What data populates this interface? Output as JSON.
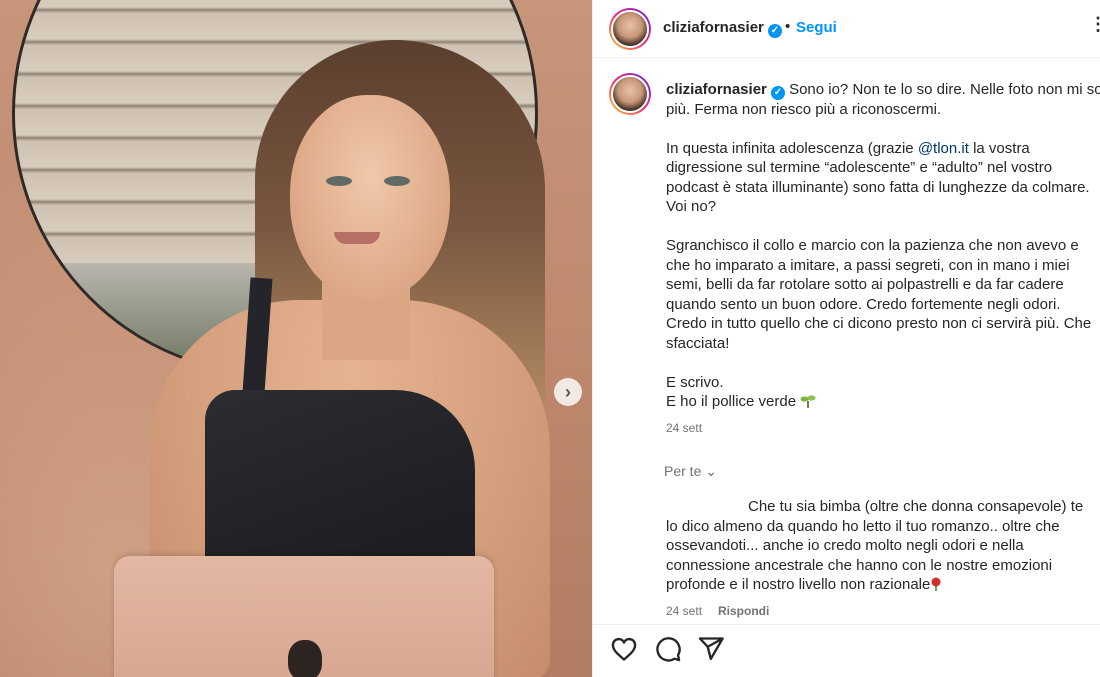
{
  "post": {
    "username": "cliziafornasier",
    "separator": "•",
    "follow_label": "Segui",
    "more_icon": "more-icon"
  },
  "caption": {
    "username": "cliziafornasier",
    "text_1": "Sono io? Non te lo so dire. Nelle foto non mi so più. Ferma non riesco più a riconoscermi.\n\nIn questa infinita adolescenza (grazie ",
    "mention": "@tlon.it",
    "text_2": " la vostra digressione sul termine “adolescente” e “adulto” nel vostro podcast è stata illuminante) sono fatta di lunghezze da colmare. Voi no?\n\nSgranchisco il collo e marcio con la pazienza che non avevo e che ho imparato a imitare, a passi segreti, con in mano i miei semi, belli da far rotolare sotto ai polpastrelli e da far cadere quando sento un buon odore. Credo fortemente negli odori. Credo in tutto quello che ci dicono presto non ci servirà più. Che sfacciata!\n\nE scrivo.\nE ho il pollice verde ",
    "timestamp": "24 sett"
  },
  "comments": {
    "filter_label": "Per te",
    "items": [
      {
        "text": "Che tu sia bimba (oltre che donna consapevole) te lo dico almeno da quando ho letto il tuo romanzo.. oltre che ossevandoti... anche io credo molto negli odori e nella connessione ancestrale che hanno con le nostre emozioni profonde e il nostro livello non razionale",
        "timestamp": "24 sett",
        "reply_label": "Rispondi"
      }
    ]
  },
  "icons": {
    "like": "heart-icon",
    "comment": "comment-icon",
    "share": "share-icon",
    "next": "chevron-right-icon",
    "verified": "verified-badge-icon"
  },
  "colors": {
    "accent": "#0095f6",
    "mention": "#00376b",
    "muted": "#737373",
    "text": "#262626"
  }
}
